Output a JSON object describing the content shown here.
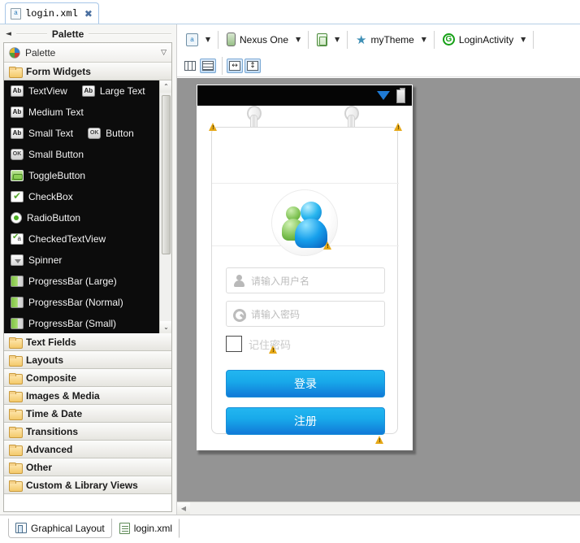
{
  "editor_tab": {
    "label": "login.xml",
    "icon": "xml-file-icon",
    "close": "✖"
  },
  "palette": {
    "title": "Palette",
    "collapse_arrow": "◄",
    "header_label": "Palette",
    "header_icon": "palette-icon",
    "header_chevron": "▽",
    "open_category": "Form Widgets",
    "widgets": [
      [
        {
          "icon": "ab-icon",
          "icon_text": "Ab",
          "label": "TextView"
        },
        {
          "icon": "ab-icon",
          "icon_text": "Ab",
          "label": "Large Text"
        }
      ],
      [
        {
          "icon": "ab-icon",
          "icon_text": "Ab",
          "label": "Medium Text"
        }
      ],
      [
        {
          "icon": "ab-icon",
          "icon_text": "Ab",
          "label": "Small Text"
        },
        {
          "icon": "ok-icon",
          "icon_text": "OK",
          "label": "Button"
        }
      ],
      [
        {
          "icon": "ok-icon",
          "icon_text": "OK",
          "label": "Small Button"
        }
      ],
      [
        {
          "icon": "togglebutton-icon",
          "icon_text": "",
          "label": "ToggleButton"
        }
      ],
      [
        {
          "icon": "checkbox-icon",
          "icon_text": "",
          "label": "CheckBox"
        }
      ],
      [
        {
          "icon": "radiobutton-icon",
          "icon_text": "",
          "label": "RadioButton"
        }
      ],
      [
        {
          "icon": "checkedtextview-icon",
          "icon_text": "a",
          "label": "CheckedTextView"
        }
      ],
      [
        {
          "icon": "spinner-icon",
          "icon_text": "",
          "label": "Spinner"
        }
      ],
      [
        {
          "icon": "progressbar-icon",
          "icon_text": "",
          "label": "ProgressBar (Large)"
        }
      ],
      [
        {
          "icon": "progressbar-icon",
          "icon_text": "",
          "label": "ProgressBar (Normal)"
        }
      ],
      [
        {
          "icon": "progressbar-icon",
          "icon_text": "",
          "label": "ProgressBar (Small)"
        }
      ]
    ],
    "scroll_up": "⌃",
    "scroll_down": "⌄",
    "categories": [
      {
        "label": "Text Fields"
      },
      {
        "label": "Layouts"
      },
      {
        "label": "Composite"
      },
      {
        "label": "Images & Media"
      },
      {
        "label": "Time & Date"
      },
      {
        "label": "Transitions"
      },
      {
        "label": "Advanced"
      },
      {
        "label": "Other"
      },
      {
        "label": "Custom & Library Views"
      }
    ]
  },
  "toolbar": {
    "config": {
      "icon": "configuration-icon",
      "label": "",
      "arrow": "▼"
    },
    "device": {
      "icon": "device-icon",
      "label": "Nexus One",
      "arrow": "▼"
    },
    "orientation": {
      "icon": "orientation-icon",
      "label": "",
      "arrow": "▼"
    },
    "theme": {
      "icon": "theme-star-icon",
      "label": "myTheme",
      "arrow": "▼"
    },
    "activity": {
      "icon": "activity-icon",
      "icon_text": "G",
      "label": "LoginActivity",
      "arrow": "▼"
    }
  },
  "toolbar2": {
    "buttons": [
      {
        "name": "show-included-columns",
        "icon": "grid-columns-icon",
        "selected": false
      },
      {
        "name": "show-layout-rows",
        "icon": "grid-rows-icon",
        "selected": true
      },
      {
        "name": "fit-width",
        "icon": "arrows-horizontal-icon",
        "glyph": "↔",
        "selected": true
      },
      {
        "name": "fit-height",
        "icon": "arrows-vertical-icon",
        "glyph": "↕",
        "selected": true
      }
    ]
  },
  "preview": {
    "status_bar": {
      "wifi": "wifi-icon",
      "battery": "battery-icon"
    },
    "avatar": "users-group-avatar-icon",
    "username_field": {
      "icon": "user-icon",
      "value": "请输入用户名"
    },
    "password_field": {
      "icon": "key-icon",
      "value": "请输入密码"
    },
    "remember": {
      "checked": false,
      "label": "记住密码"
    },
    "login_button": "登录",
    "register_button": "注册",
    "warning_icon": "warning-triangle-icon",
    "warning_count": 5,
    "accent_color": "#18a9ea"
  },
  "canvas": {
    "scroll_left_arrow": "◀"
  },
  "bottom_tabs": [
    {
      "label": "Graphical Layout",
      "icon": "graphical-layout-icon",
      "active": true
    },
    {
      "label": "login.xml",
      "icon": "xml-text-icon",
      "active": false
    }
  ]
}
